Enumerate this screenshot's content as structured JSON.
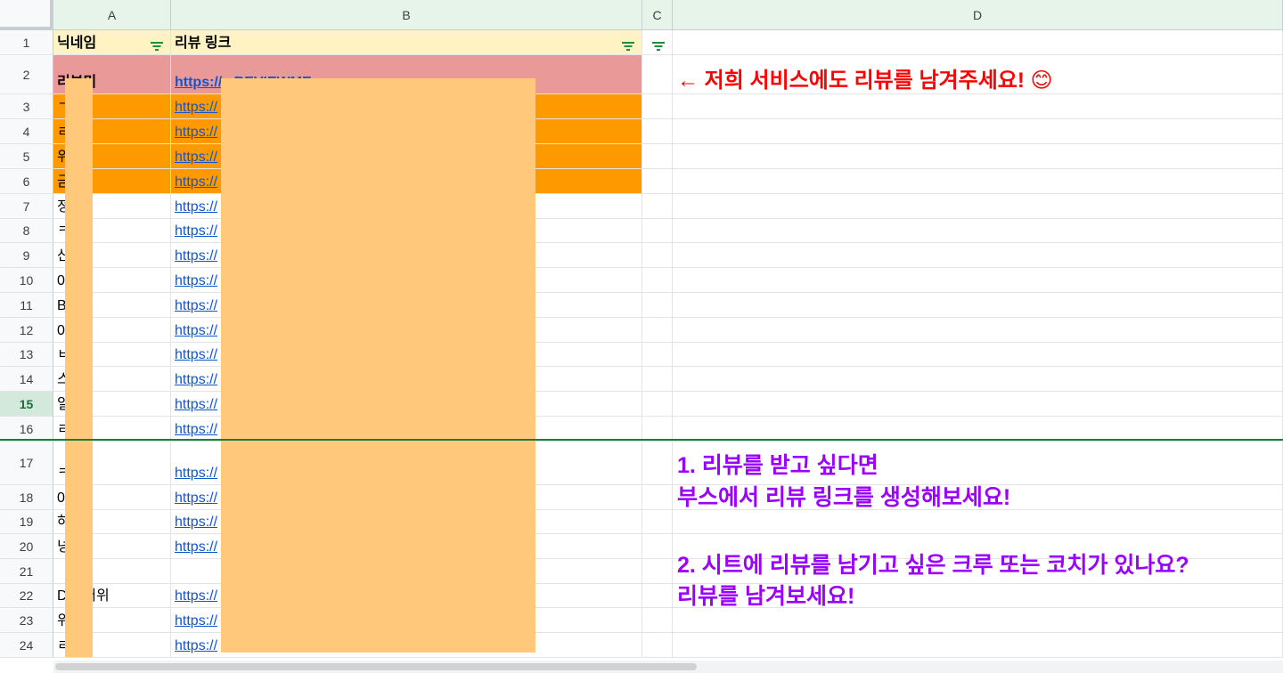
{
  "columns": [
    "A",
    "B",
    "C",
    "D"
  ],
  "headers": {
    "nickname": "닉네임",
    "review_link": "리뷰 링크"
  },
  "rows": [
    {
      "num": "1"
    },
    {
      "num": "2",
      "a": "리뷰미",
      "b": "https://...REVIEWME"
    },
    {
      "num": "3",
      "a": "ㄱ",
      "b": "https://"
    },
    {
      "num": "4",
      "a": "ㄹ",
      "b": "https://"
    },
    {
      "num": "5",
      "a": "위",
      "b": "https://"
    },
    {
      "num": "6",
      "a": "금",
      "b": "https://"
    },
    {
      "num": "7",
      "a": "정",
      "b": "https://"
    },
    {
      "num": "8",
      "a": "ㅋ",
      "b": "https://"
    },
    {
      "num": "9",
      "a": "산",
      "b": "https://"
    },
    {
      "num": "10",
      "a": "0",
      "b": "https://"
    },
    {
      "num": "11",
      "a": "B",
      "b": "https://"
    },
    {
      "num": "12",
      "a": "0",
      "b": "https://"
    },
    {
      "num": "13",
      "a": "ㅂ",
      "b": "https://"
    },
    {
      "num": "14",
      "a": "스",
      "b": "https://"
    },
    {
      "num": "15",
      "a": "일",
      "b": "https://"
    },
    {
      "num": "16",
      "a": "ㄹ",
      "b": "https://"
    },
    {
      "num": "17",
      "a": "ㅋ",
      "b": "https://"
    },
    {
      "num": "18",
      "a": "0",
      "b": "https://"
    },
    {
      "num": "19",
      "a": "하",
      "b": "https://"
    },
    {
      "num": "20",
      "a": "넝",
      "b": "https://"
    },
    {
      "num": "21",
      "a": "",
      "b": ""
    },
    {
      "num": "22",
      "a": "D  ...어위",
      "b": "https://"
    },
    {
      "num": "23",
      "a": "위",
      "b": "https://"
    },
    {
      "num": "24",
      "a": "ㄹ",
      "b": "https://"
    }
  ],
  "active_row": "15",
  "notes": {
    "top": "← 저희 서비스에도 리뷰를 남겨주세요! 😊",
    "n1_line1": "1. 리뷰를 받고 싶다면",
    "n1_line2": "부스에서 리뷰 링크를 생성해보세요!",
    "n2_line1": "2. 시트에 리뷰를 남기고 싶은 크루 또는 코치가 있나요?",
    "n2_line2": "리뷰를 남겨보세요!"
  },
  "colors": {
    "header_row": "#fff3c4",
    "row2_fill": "#ea9999",
    "orange_fill": "#ff9900",
    "redaction": "#ffc87a",
    "note_red": "#ff0000",
    "note_purple": "#9900ff",
    "link": "#1155cc"
  }
}
